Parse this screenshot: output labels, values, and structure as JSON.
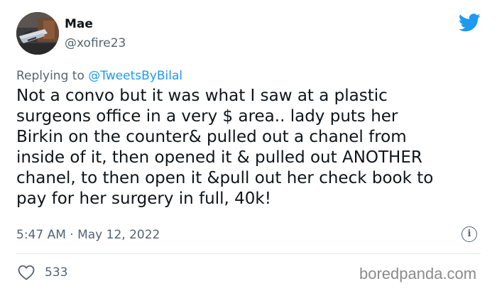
{
  "author": {
    "display_name": "Mae",
    "handle": "@xofire23"
  },
  "reply": {
    "prefix": "Replying to",
    "mention": "@TweetsByBilal"
  },
  "tweet": {
    "text": "Not a convo but it was what I saw at a plastic\nsurgeons office in a very $ area.. lady puts her\nBirkin on the counter& pulled out a chanel from\ninside of it, then opened it & pulled out ANOTHER\nchanel, to then open it &pull out her check book to\npay for her surgery in full, 40k!",
    "timestamp": "5:47 AM · May 12, 2022"
  },
  "actions": {
    "like_count": "533",
    "like_icon": "heart-outline-icon",
    "info_icon": "info-circle-icon"
  },
  "watermark": "boredpanda.com",
  "colors": {
    "brand_blue": "#1d9bf0",
    "secondary_text": "#536471",
    "primary_text": "#0f1419"
  }
}
